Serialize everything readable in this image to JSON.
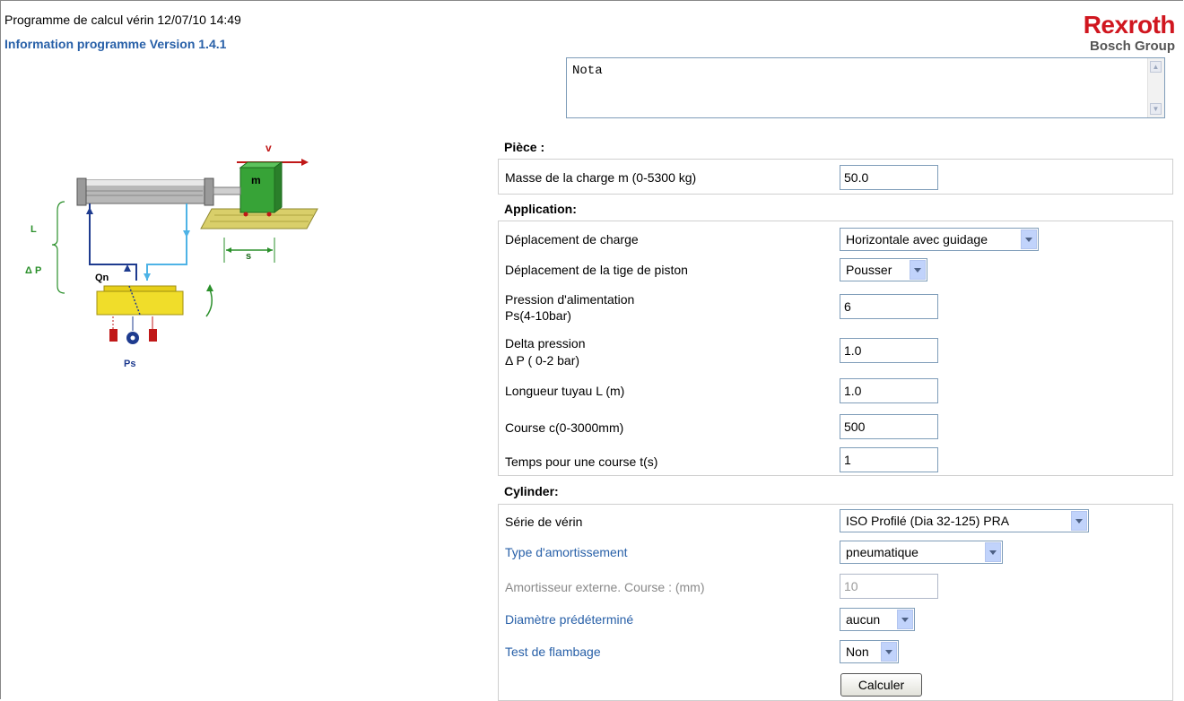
{
  "header": {
    "title": "Programme de calcul vérin 12/07/10 14:49",
    "version": "Information programme Version 1.4.1"
  },
  "logo": {
    "brand": "Rexroth",
    "sub": "Bosch Group"
  },
  "diagram": {
    "v": "v",
    "m": "m",
    "s": "s",
    "L": "L",
    "dp": "Δ P",
    "qn": "Qn",
    "ps": "Ps"
  },
  "nota": {
    "value": "Nota"
  },
  "piece": {
    "title": "Pièce :",
    "masse_label": "Masse de la charge m (0-5300 kg)",
    "masse_value": "50.0"
  },
  "application": {
    "title": "Application:",
    "deplacement_charge_label": "Déplacement de charge",
    "deplacement_charge_value": "Horizontale avec guidage",
    "deplacement_tige_label": "Déplacement de la tige de piston",
    "deplacement_tige_value": "Pousser",
    "pression_label_1": "Pression d'alimentation",
    "pression_label_2": "Ps(4-10bar)",
    "pression_value": "6",
    "delta_label_1": "Delta pression",
    "delta_label_2": "Δ P ( 0-2 bar)",
    "delta_value": "1.0",
    "longueur_label": "Longueur tuyau L (m)",
    "longueur_value": "1.0",
    "course_label": "Course c(0-3000mm)",
    "course_value": "500",
    "temps_label": "Temps pour une course t(s)",
    "temps_value": "1"
  },
  "cylinder": {
    "title": "Cylinder:",
    "serie_label": "Série de vérin",
    "serie_value": "ISO Profilé (Dia 32-125) PRA",
    "amortissement_label": "Type d'amortissement",
    "amortissement_value": "pneumatique",
    "amortisseur_label": "Amortisseur externe. Course : (mm)",
    "amortisseur_value": "10",
    "diametre_label": "Diamètre prédéterminé",
    "diametre_value": "aucun",
    "flambage_label": "Test de flambage",
    "flambage_value": "Non"
  },
  "actions": {
    "calculer": "Calculer"
  },
  "colors": {
    "brand_red": "#d0161f",
    "link_blue": "#2860a8",
    "select_button": "#c1d3fb"
  }
}
